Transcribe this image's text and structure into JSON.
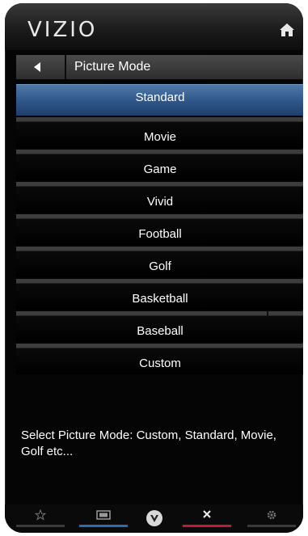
{
  "app": {
    "logo": "VIZIO"
  },
  "header": {
    "title": "Picture Mode"
  },
  "menu": {
    "items": [
      {
        "label": "Standard",
        "selected": true
      },
      {
        "label": "Movie",
        "selected": false
      },
      {
        "label": "Game",
        "selected": false
      },
      {
        "label": "Vivid",
        "selected": false
      },
      {
        "label": "Football",
        "selected": false
      },
      {
        "label": "Golf",
        "selected": false
      },
      {
        "label": "Basketball",
        "selected": false
      },
      {
        "label": "Baseball",
        "selected": false
      },
      {
        "label": "Custom",
        "selected": false
      }
    ]
  },
  "description": "Select Picture Mode: Custom, Standard, Movie, Golf etc...",
  "bottom_bar": {
    "buttons": [
      {
        "icon": "star-icon",
        "underline_color": "#3a3a3a"
      },
      {
        "icon": "tv-input-icon",
        "underline_color": "#2d6bb5"
      },
      {
        "icon": "vizio-v-icon",
        "underline_color": "#3a3a3a"
      },
      {
        "icon": "close-icon",
        "underline_color": "#c8183a"
      },
      {
        "icon": "gear-icon",
        "underline_color": "#3a3a3a"
      }
    ]
  },
  "colors": {
    "selected": "#2f5588",
    "background": "#050505",
    "accent_red": "#c8183a",
    "accent_blue": "#2d6bb5"
  }
}
